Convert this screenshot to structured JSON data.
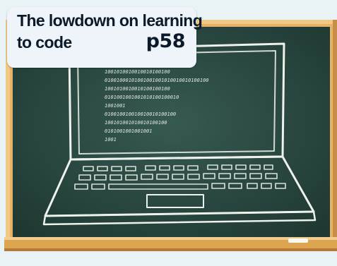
{
  "teaser": {
    "line1": "The lowdown on learning",
    "line2": "to code",
    "page": "p58"
  },
  "colors": {
    "board": "#2c4a42",
    "frame": "#e5b368",
    "background": "#e9f3f6",
    "chalk": "#f2f5ef"
  },
  "illustration": {
    "subject": "chalk-drawn-laptop-on-blackboard",
    "code_lines": [
      "1001010010010010100100",
      "01001000101001001001010010010100100",
      "1001010010010100100100",
      "0101001001001010100100010",
      "1001001",
      "010010010010010010100100",
      "100101001010010100100",
      "0101001001001001",
      "1001"
    ]
  }
}
